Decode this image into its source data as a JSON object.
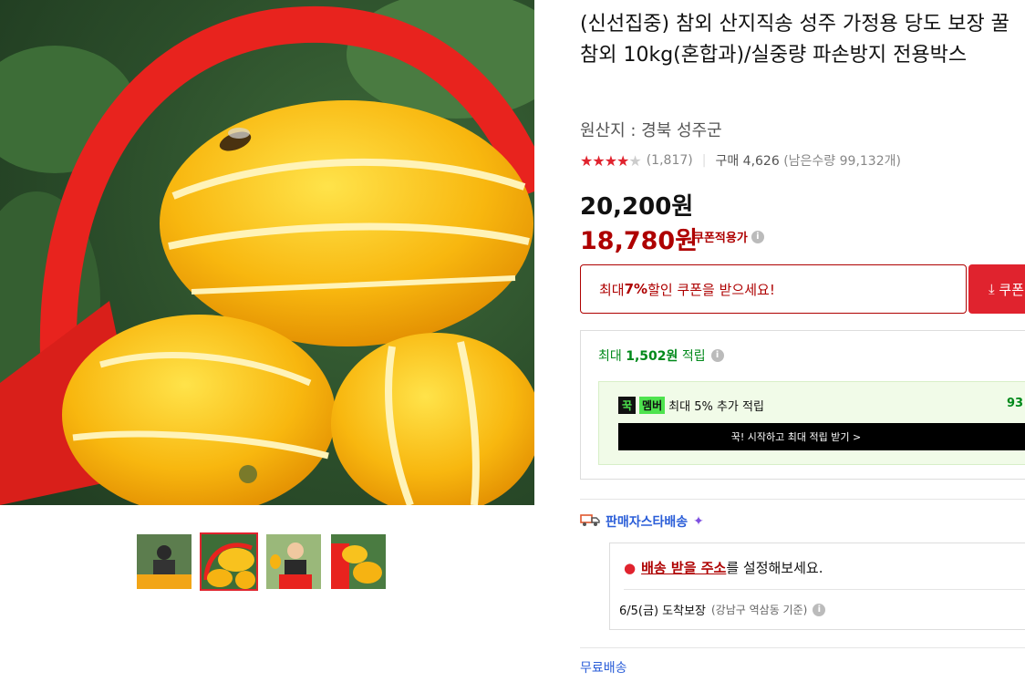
{
  "product": {
    "title": "(신선집중) 참외 산지직송 성주 가정용 당도 보장 꿀 참외 10kg(혼합과)/실중량 파손방지 전용박스",
    "origin": "원산지 : 경북 성주군",
    "rating": 4,
    "rating_count": "(1,817)",
    "purchase_count": "구매 4,626",
    "remaining": "(남은수량 99,132개)",
    "original_price": "20,200원",
    "sale_price": "18,780원",
    "coupon_applicable": "쿠폰적용가"
  },
  "coupon": {
    "prefix": "최대 ",
    "percent": "7%",
    "suffix": " 할인 쿠폰을 받으세요!",
    "button_label": "쿠폰"
  },
  "points": {
    "prefix": "최대 ",
    "amount": "1,502원",
    "suffix": " 적립",
    "member_ggok": "꾹",
    "member_tag": "멤버",
    "member_text": "최대 5% 추가 적립",
    "member_rate": "93",
    "member_button": "꾹! 시작하고 최대 적립 받기 >"
  },
  "delivery": {
    "label": "판매자스타배송",
    "address_link": "배송 받을 주소",
    "address_suffix": "를 설정해보세요.",
    "arrival": "6/5(금) 도착보장",
    "arrival_note": "(강남구 역삼동 기준)",
    "free_shipping": "무료배송"
  },
  "colors": {
    "accent_red": "#e0232e",
    "price_red": "#ae0000",
    "point_green": "#00891a",
    "delivery_blue": "#2b5ed8"
  },
  "thumbnails": [
    "farmer-with-melons",
    "melons-in-basket",
    "farmer-holding-melon",
    "melons-in-crate"
  ],
  "selected_thumbnail": 1
}
